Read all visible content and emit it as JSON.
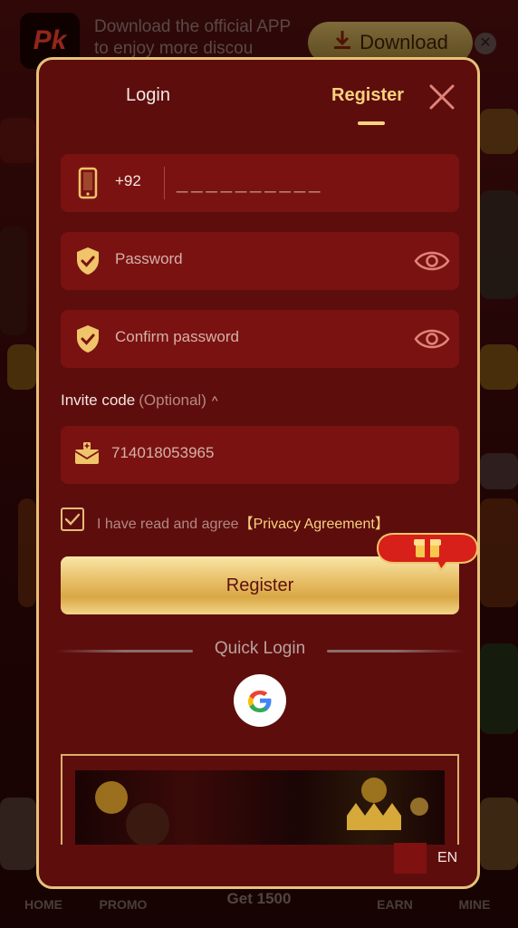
{
  "banner": {
    "logo_text": "Pk",
    "message": "Download the official APP to enjoy more discou",
    "download_label": "Download",
    "close_label": "✕"
  },
  "bottom_nav": {
    "items": [
      "HOME",
      "PROMO",
      "EARN",
      "MINE"
    ],
    "center_label": "Get 1500"
  },
  "modal": {
    "tabs": {
      "login": "Login",
      "register": "Register"
    },
    "active_tab": "register",
    "phone": {
      "country_code": "+92",
      "placeholder": "__________"
    },
    "password": {
      "placeholder": "Password"
    },
    "confirm_password": {
      "placeholder": "Confirm password"
    },
    "invite": {
      "label": "Invite code",
      "optional": "(Optional)",
      "value": "714018053965"
    },
    "agreement": {
      "checked": true,
      "text": "I have read and agree",
      "link": "【Privacy Agreement】"
    },
    "register_button": "Register",
    "quick_login": "Quick Login",
    "language": "EN"
  },
  "colors": {
    "accent": "#f6d27e",
    "modal_bg": "#5e0d0d",
    "field_bg": "#7a1212",
    "border": "#e6c27a"
  }
}
